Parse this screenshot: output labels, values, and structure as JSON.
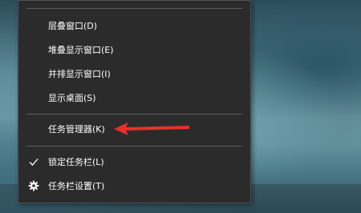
{
  "menu": {
    "items": [
      {
        "label": "层叠窗口(D)"
      },
      {
        "label": "堆叠显示窗口(E)"
      },
      {
        "label": "并排显示窗口(I)"
      },
      {
        "label": "显示桌面(S)"
      },
      {
        "label": "任务管理器(K)"
      },
      {
        "label": "锁定任务栏(L)",
        "icon": "checkmark-icon",
        "checked": true
      },
      {
        "label": "任务栏设置(T)",
        "icon": "gear-icon"
      }
    ]
  },
  "annotation": {
    "icon": "red-arrow-icon",
    "color": "#e8302b"
  },
  "colors": {
    "menu_background": "#2b2b2b",
    "menu_text": "#ffffff",
    "separator": "#5a5a5a"
  }
}
